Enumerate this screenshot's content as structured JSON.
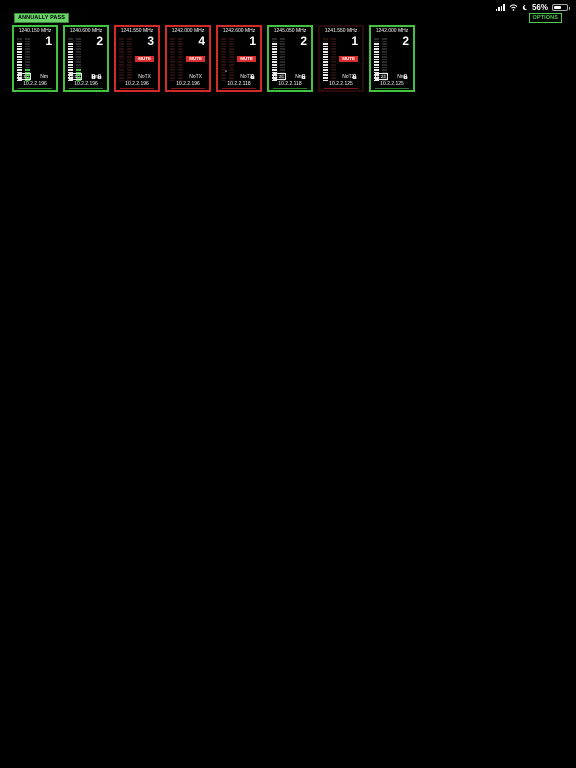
{
  "status_bar": {
    "battery": "56%",
    "battery_fraction": 0.56,
    "icons": [
      "signal-icon",
      "wifi-icon",
      "moon-icon",
      "battery-icon"
    ]
  },
  "header": {
    "annual_badge": "ANNUALLY PASS",
    "options_label": "OPTIONS"
  },
  "colors": {
    "ok": "#42c23d",
    "alarm": "#d32a2a",
    "mute": "#d72f2f",
    "af_meter": "#3ec63e",
    "rf_meter": "#e8e8e8"
  },
  "channels": [
    {
      "frequency": "1240.150 MHz",
      "number": "1",
      "state": "ok",
      "rf_level": 0.88,
      "af_level": 0.3,
      "mute": "",
      "battery": "4:50",
      "status": "Nm",
      "ip": "10.2.2.196",
      "locks": 0
    },
    {
      "frequency": "1240.600 MHz",
      "number": "2",
      "state": "ok",
      "rf_level": 0.88,
      "af_level": 0.3,
      "mute": "",
      "battery": "5:00",
      "status": "Nm",
      "ip": "10.2.2.196",
      "locks": 2
    },
    {
      "frequency": "1241.550 MHz",
      "number": "3",
      "state": "alarm",
      "rf_level": 0,
      "af_level": 0,
      "mute": "MUTE",
      "battery": "",
      "status": "NoTX",
      "ip": "10.2.2.196",
      "locks": 0
    },
    {
      "frequency": "1242.000 MHz",
      "number": "4",
      "state": "alarm",
      "rf_level": 0,
      "af_level": 0,
      "mute": "MUTE",
      "battery": "",
      "status": "NoTX",
      "ip": "10.2.2.196",
      "locks": 0
    },
    {
      "frequency": "1242.600 MHz",
      "number": "1",
      "state": "alarm",
      "rf_level": 0,
      "af_level": 0,
      "mute": "MUTE",
      "battery": "",
      "status": "NoTX",
      "ip": "10.2.2.118",
      "locks": 1,
      "dash": "-"
    },
    {
      "frequency": "1245.050 MHz",
      "number": "2",
      "state": "ok",
      "rf_level": 0.9,
      "af_level": 0,
      "mute": "",
      "battery": "5:26",
      "status": "Nm",
      "ip": "10.2.2.118",
      "locks": 1
    },
    {
      "frequency": "1241.550 MHz",
      "number": "1",
      "state": "dim",
      "rf_level": 0.9,
      "af_level": 0,
      "mute": "MUTE",
      "battery": "",
      "status": "NoTX",
      "ip": "10.2.2.125",
      "locks": 1
    },
    {
      "frequency": "1242.000 MHz",
      "number": "2",
      "state": "ok",
      "rf_level": 0.9,
      "af_level": 0,
      "mute": "",
      "battery": "4:24",
      "status": "Nm",
      "ip": "10.2.2.125",
      "locks": 1
    }
  ]
}
